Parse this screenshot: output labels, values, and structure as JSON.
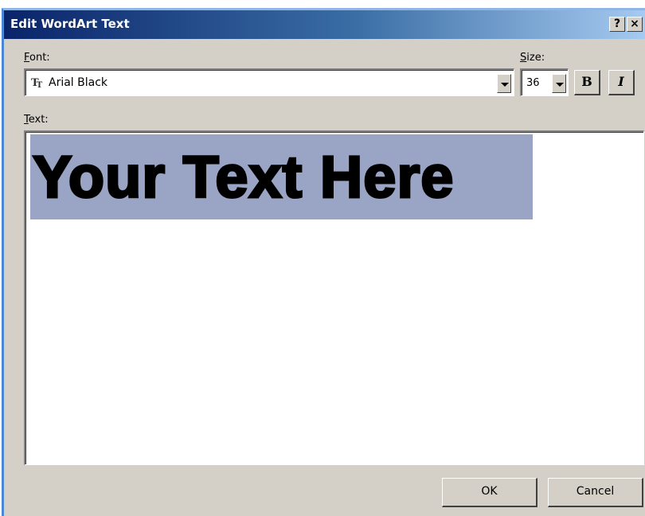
{
  "dialog": {
    "title": "Edit WordArt Text",
    "help_label": "?",
    "close_label": "×"
  },
  "font": {
    "label_mnemonic": "F",
    "label_rest": "ont:",
    "value": "Arial Black"
  },
  "size": {
    "label_mnemonic": "S",
    "label_rest": "ize:",
    "value": "36"
  },
  "format": {
    "bold_label": "B",
    "italic_label": "I"
  },
  "text": {
    "label_mnemonic": "T",
    "label_rest": "ext:",
    "content": "Your Text Here",
    "selected": true,
    "selection_color": "#9aa4c4"
  },
  "buttons": {
    "ok": "OK",
    "cancel": "Cancel"
  },
  "colors": {
    "titlebar_start": "#0a246a",
    "titlebar_end": "#a6caf0",
    "dialog_face": "#d4d0c8"
  }
}
